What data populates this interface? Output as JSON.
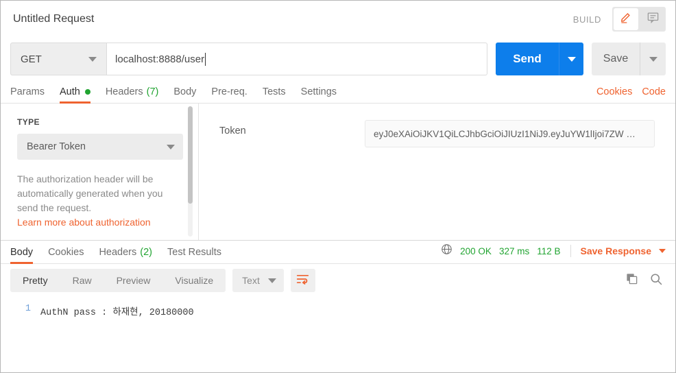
{
  "window": {
    "request_title": "Untitled Request",
    "build_label": "BUILD"
  },
  "header_icons": {
    "edit": "edit-pencil-icon",
    "comment": "comment-bubble-icon"
  },
  "url_bar": {
    "method": "GET",
    "url": "localhost:8888/user",
    "send_label": "Send",
    "save_label": "Save"
  },
  "request_tabs": {
    "items": [
      {
        "label": "Params",
        "active": false,
        "dot": false,
        "count": ""
      },
      {
        "label": "Auth",
        "active": true,
        "dot": true,
        "count": ""
      },
      {
        "label": "Headers",
        "active": false,
        "dot": false,
        "count": "(7)"
      },
      {
        "label": "Body",
        "active": false,
        "dot": false,
        "count": ""
      },
      {
        "label": "Pre-req.",
        "active": false,
        "dot": false,
        "count": ""
      },
      {
        "label": "Tests",
        "active": false,
        "dot": false,
        "count": ""
      },
      {
        "label": "Settings",
        "active": false,
        "dot": false,
        "count": ""
      }
    ],
    "cookies_label": "Cookies",
    "code_label": "Code"
  },
  "auth_panel": {
    "type_label": "TYPE",
    "type_value": "Bearer Token",
    "description": "The authorization header will be automatically generated when you send the request.",
    "learn_more": "Learn more about authorization",
    "token_label": "Token",
    "token_value": "eyJ0eXAiOiJKV1QiLCJhbGciOiJIUzI1NiJ9.eyJuYW1lIjoi7ZW …"
  },
  "response_tabs": {
    "items": [
      {
        "label": "Body",
        "active": true,
        "count": ""
      },
      {
        "label": "Cookies",
        "active": false,
        "count": ""
      },
      {
        "label": "Headers",
        "active": false,
        "count": "(2)"
      },
      {
        "label": "Test Results",
        "active": false,
        "count": ""
      }
    ],
    "status": "200 OK",
    "time": "327 ms",
    "size": "112 B",
    "save_response_label": "Save Response"
  },
  "response_toolbar": {
    "views": [
      {
        "label": "Pretty",
        "active": true
      },
      {
        "label": "Raw",
        "active": false
      },
      {
        "label": "Preview",
        "active": false
      },
      {
        "label": "Visualize",
        "active": false
      }
    ],
    "format": "Text",
    "wrap_icon": "word-wrap-icon",
    "copy_icon": "copy-icon",
    "search_icon": "search-icon"
  },
  "response_body": {
    "lines": [
      {
        "number": "1",
        "text": "AuthN pass : 하재현, 20180000"
      }
    ]
  },
  "colors": {
    "accent_orange": "#ef6330",
    "send_blue": "#0d7eeb",
    "success_green": "#21a431"
  }
}
